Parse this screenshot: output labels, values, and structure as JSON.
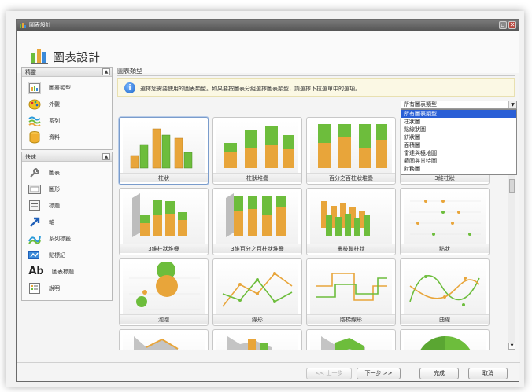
{
  "window": {
    "title": "圖表設計",
    "close_glyph": "✕"
  },
  "header": {
    "title": "圖表設計"
  },
  "steps_panel": {
    "title": "精靈",
    "items": [
      {
        "label": "圖表類型",
        "icon": "chart-type-icon",
        "active": true
      },
      {
        "label": "外觀",
        "icon": "appearance-icon",
        "active": false
      },
      {
        "label": "系列",
        "icon": "series-icon",
        "active": false
      },
      {
        "label": "資料",
        "icon": "data-icon",
        "active": false
      }
    ]
  },
  "options_panel": {
    "title": "快速",
    "items": [
      {
        "label": "圖表",
        "icon": "wrench-icon"
      },
      {
        "label": "圖形",
        "icon": "plot-area-icon"
      },
      {
        "label": "標題",
        "icon": "titles-icon"
      },
      {
        "label": "軸",
        "icon": "axis-icon"
      },
      {
        "label": "系列標籤",
        "icon": "series-labels-icon"
      },
      {
        "label": "點標記",
        "icon": "point-labels-icon"
      },
      {
        "label": "圖表標題",
        "icon": "chart-title-icon"
      },
      {
        "label": "說明",
        "icon": "legend-icon"
      }
    ]
  },
  "main": {
    "title": "圖表類型",
    "info": "選擇您需要使用的圖表類型。如果要按圖表分組選擇圖表類型，請選擇下拉選單中的選項。",
    "filter": {
      "selected": "所有圖表類型",
      "options": [
        "所有圖表類型",
        "柱狀圖",
        "點線狀圖",
        "餅狀圖",
        "面積圖",
        "雷達與極地圖",
        "範圍與甘特圖",
        "財務圖"
      ]
    },
    "chart_types": [
      "柱狀",
      "柱狀堆疊",
      "百分之百柱狀堆疊",
      "3維柱狀",
      "3維柱狀堆疊",
      "3維百分之百柱狀堆疊",
      "叢枝聯柱狀",
      "點狀",
      "泡泡",
      "線形",
      "階梯線形",
      "曲線"
    ]
  },
  "footer": {
    "back": "<< 上一步",
    "next": "下一步 >>",
    "finish": "完成",
    "cancel": "取消"
  },
  "colors": {
    "orange": "#e8a53a",
    "green": "#6dbd3c",
    "selection": "#2a5fd6",
    "title_bar": "#5e5e5e"
  }
}
